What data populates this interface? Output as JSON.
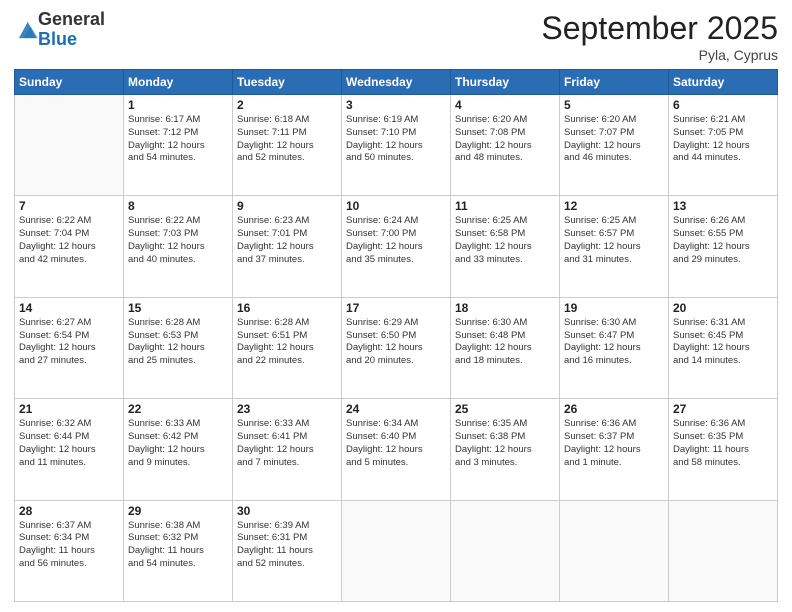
{
  "logo": {
    "general": "General",
    "blue": "Blue"
  },
  "title": "September 2025",
  "location": "Pyla, Cyprus",
  "weekdays": [
    "Sunday",
    "Monday",
    "Tuesday",
    "Wednesday",
    "Thursday",
    "Friday",
    "Saturday"
  ],
  "weeks": [
    [
      {
        "day": "",
        "info": ""
      },
      {
        "day": "1",
        "info": "Sunrise: 6:17 AM\nSunset: 7:12 PM\nDaylight: 12 hours\nand 54 minutes."
      },
      {
        "day": "2",
        "info": "Sunrise: 6:18 AM\nSunset: 7:11 PM\nDaylight: 12 hours\nand 52 minutes."
      },
      {
        "day": "3",
        "info": "Sunrise: 6:19 AM\nSunset: 7:10 PM\nDaylight: 12 hours\nand 50 minutes."
      },
      {
        "day": "4",
        "info": "Sunrise: 6:20 AM\nSunset: 7:08 PM\nDaylight: 12 hours\nand 48 minutes."
      },
      {
        "day": "5",
        "info": "Sunrise: 6:20 AM\nSunset: 7:07 PM\nDaylight: 12 hours\nand 46 minutes."
      },
      {
        "day": "6",
        "info": "Sunrise: 6:21 AM\nSunset: 7:05 PM\nDaylight: 12 hours\nand 44 minutes."
      }
    ],
    [
      {
        "day": "7",
        "info": "Sunrise: 6:22 AM\nSunset: 7:04 PM\nDaylight: 12 hours\nand 42 minutes."
      },
      {
        "day": "8",
        "info": "Sunrise: 6:22 AM\nSunset: 7:03 PM\nDaylight: 12 hours\nand 40 minutes."
      },
      {
        "day": "9",
        "info": "Sunrise: 6:23 AM\nSunset: 7:01 PM\nDaylight: 12 hours\nand 37 minutes."
      },
      {
        "day": "10",
        "info": "Sunrise: 6:24 AM\nSunset: 7:00 PM\nDaylight: 12 hours\nand 35 minutes."
      },
      {
        "day": "11",
        "info": "Sunrise: 6:25 AM\nSunset: 6:58 PM\nDaylight: 12 hours\nand 33 minutes."
      },
      {
        "day": "12",
        "info": "Sunrise: 6:25 AM\nSunset: 6:57 PM\nDaylight: 12 hours\nand 31 minutes."
      },
      {
        "day": "13",
        "info": "Sunrise: 6:26 AM\nSunset: 6:55 PM\nDaylight: 12 hours\nand 29 minutes."
      }
    ],
    [
      {
        "day": "14",
        "info": "Sunrise: 6:27 AM\nSunset: 6:54 PM\nDaylight: 12 hours\nand 27 minutes."
      },
      {
        "day": "15",
        "info": "Sunrise: 6:28 AM\nSunset: 6:53 PM\nDaylight: 12 hours\nand 25 minutes."
      },
      {
        "day": "16",
        "info": "Sunrise: 6:28 AM\nSunset: 6:51 PM\nDaylight: 12 hours\nand 22 minutes."
      },
      {
        "day": "17",
        "info": "Sunrise: 6:29 AM\nSunset: 6:50 PM\nDaylight: 12 hours\nand 20 minutes."
      },
      {
        "day": "18",
        "info": "Sunrise: 6:30 AM\nSunset: 6:48 PM\nDaylight: 12 hours\nand 18 minutes."
      },
      {
        "day": "19",
        "info": "Sunrise: 6:30 AM\nSunset: 6:47 PM\nDaylight: 12 hours\nand 16 minutes."
      },
      {
        "day": "20",
        "info": "Sunrise: 6:31 AM\nSunset: 6:45 PM\nDaylight: 12 hours\nand 14 minutes."
      }
    ],
    [
      {
        "day": "21",
        "info": "Sunrise: 6:32 AM\nSunset: 6:44 PM\nDaylight: 12 hours\nand 11 minutes."
      },
      {
        "day": "22",
        "info": "Sunrise: 6:33 AM\nSunset: 6:42 PM\nDaylight: 12 hours\nand 9 minutes."
      },
      {
        "day": "23",
        "info": "Sunrise: 6:33 AM\nSunset: 6:41 PM\nDaylight: 12 hours\nand 7 minutes."
      },
      {
        "day": "24",
        "info": "Sunrise: 6:34 AM\nSunset: 6:40 PM\nDaylight: 12 hours\nand 5 minutes."
      },
      {
        "day": "25",
        "info": "Sunrise: 6:35 AM\nSunset: 6:38 PM\nDaylight: 12 hours\nand 3 minutes."
      },
      {
        "day": "26",
        "info": "Sunrise: 6:36 AM\nSunset: 6:37 PM\nDaylight: 12 hours\nand 1 minute."
      },
      {
        "day": "27",
        "info": "Sunrise: 6:36 AM\nSunset: 6:35 PM\nDaylight: 11 hours\nand 58 minutes."
      }
    ],
    [
      {
        "day": "28",
        "info": "Sunrise: 6:37 AM\nSunset: 6:34 PM\nDaylight: 11 hours\nand 56 minutes."
      },
      {
        "day": "29",
        "info": "Sunrise: 6:38 AM\nSunset: 6:32 PM\nDaylight: 11 hours\nand 54 minutes."
      },
      {
        "day": "30",
        "info": "Sunrise: 6:39 AM\nSunset: 6:31 PM\nDaylight: 11 hours\nand 52 minutes."
      },
      {
        "day": "",
        "info": ""
      },
      {
        "day": "",
        "info": ""
      },
      {
        "day": "",
        "info": ""
      },
      {
        "day": "",
        "info": ""
      }
    ]
  ]
}
